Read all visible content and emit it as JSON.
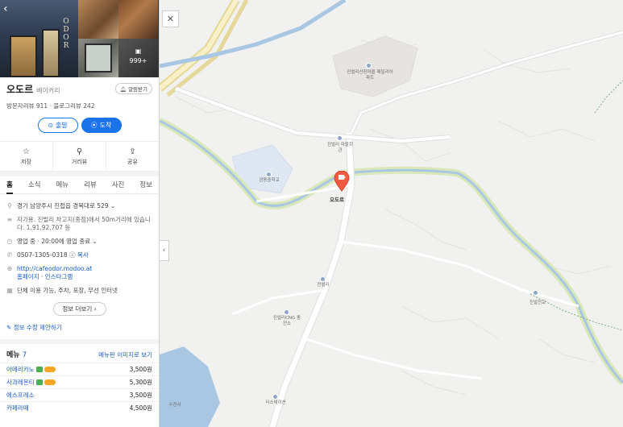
{
  "place": {
    "name": "오도르",
    "category": "베이커리",
    "notify_label": "알림받기",
    "reviews": "방문자리뷰 911 · 블로그리뷰 242",
    "photo_more": "999+",
    "sign_text": "O D O R"
  },
  "buttons": {
    "depart": "출발",
    "arrive": "도착"
  },
  "actions": [
    {
      "label": "저장",
      "icon": "star-icon"
    },
    {
      "label": "거리뷰",
      "icon": "street-view-icon"
    },
    {
      "label": "공유",
      "icon": "share-icon"
    }
  ],
  "tabs": [
    "홈",
    "소식",
    "메뉴",
    "리뷰",
    "사진",
    "정보"
  ],
  "active_tab": "홈",
  "info": {
    "address": "경기 남양주시 진접읍 경복대로 529",
    "directions": "자가용. 진벌리 차고지(종점)에서 50m거리에 있습니다. 1,91,92,707 등",
    "hours": "영업 중 · 20:00에 영업 종료",
    "phone": "0507-1305-0318",
    "copy_label": "복사",
    "website": "http://cafeodor.modoo.at",
    "homepage": "홈페이지",
    "instagram": "인스타그램",
    "facilities": "단체 이용 가능, 주차, 포장, 무선 인터넷",
    "more_info": "정보 더보기",
    "suggest_edit": "정보 수정 제안하기"
  },
  "menu": {
    "title": "메뉴",
    "count": "7",
    "image_link": "메뉴판 이미지로 보기",
    "items": [
      {
        "name": "아메리카노",
        "price": "3,500원",
        "badges": true
      },
      {
        "name": "사과레몬티",
        "price": "5,300원",
        "badges": true
      },
      {
        "name": "에스프레소",
        "price": "3,500원",
        "badges": false
      },
      {
        "name": "카페라떼",
        "price": "4,500원",
        "badges": false
      }
    ]
  },
  "map": {
    "pin_label": "오도르",
    "pois": [
      {
        "label": "진벌리산장마을 패밀리아파트"
      },
      {
        "label": "진벌리 마을회관"
      },
      {
        "label": "광동중학교"
      },
      {
        "label": "진벌리"
      },
      {
        "label": "진벌리CNG 충전소"
      },
      {
        "label": "티스테이션"
      },
      {
        "label": "진벌천교"
      },
      {
        "label": "수진사"
      }
    ],
    "colors": {
      "pin": "#ef5a43",
      "river": "#a9c7e3",
      "river_bank": "#d8e8b8",
      "road": "#ffffff",
      "highway": "#f5d97a"
    }
  }
}
